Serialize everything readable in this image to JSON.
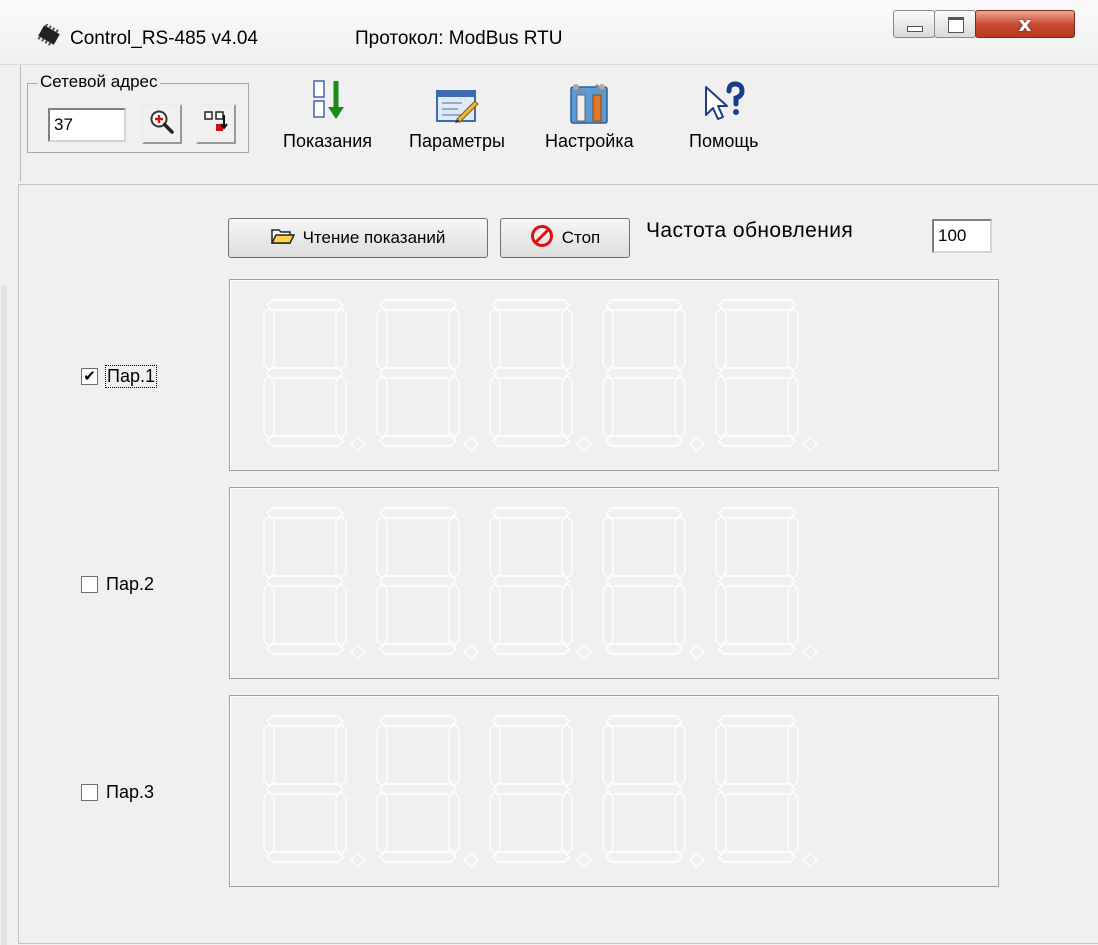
{
  "window": {
    "title": "Control_RS-485 v4.04",
    "protocol": "Протокол: ModBus RTU",
    "close_glyph": "x"
  },
  "toolbar": {
    "address_group_label": "Сетевой адрес",
    "address_value": "37",
    "buttons": [
      {
        "label": "Показания",
        "icon": "readings-icon"
      },
      {
        "label": "Параметры",
        "icon": "parameters-icon"
      },
      {
        "label": "Настройка",
        "icon": "settings-icon"
      },
      {
        "label": "Помощь",
        "icon": "help-icon"
      }
    ]
  },
  "main": {
    "read_button_label": "Чтение показаний",
    "stop_button_label": "Стоп",
    "refresh_rate_label": "Частота обновления",
    "refresh_rate_value": "100",
    "params": [
      {
        "label": "Пар.1",
        "checked": true,
        "focused": true
      },
      {
        "label": "Пар.2",
        "checked": false,
        "focused": false
      },
      {
        "label": "Пар.3",
        "checked": false,
        "focused": false
      }
    ],
    "digits_per_display": 5
  },
  "colors": {
    "window_bg": "#f0f0f0",
    "segment_outline": "#ffffff",
    "close_button": "#c7462f"
  }
}
